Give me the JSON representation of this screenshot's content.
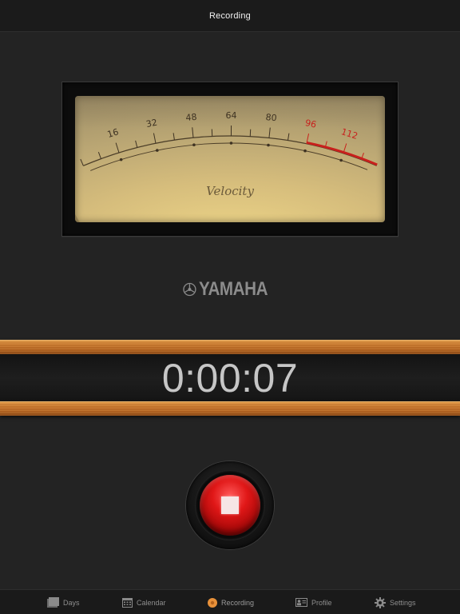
{
  "nav": {
    "title": "Recording"
  },
  "meter": {
    "label": "Velocity",
    "scale_labels": [
      "16",
      "32",
      "48",
      "64",
      "80",
      "96",
      "112"
    ],
    "scale_values": [
      16,
      32,
      48,
      64,
      80,
      96,
      112
    ],
    "scale_max": 127,
    "red_zone_start": 96,
    "needle_value": 0
  },
  "brand": {
    "name": "YAMAHA"
  },
  "timer": {
    "elapsed": "0:00:07"
  },
  "record": {
    "state": "recording"
  },
  "tabs": [
    {
      "label": "Days",
      "icon": "days-icon"
    },
    {
      "label": "Calendar",
      "icon": "calendar-icon"
    },
    {
      "label": "Recording",
      "icon": "recording-icon",
      "active": true
    },
    {
      "label": "Profile",
      "icon": "profile-icon"
    },
    {
      "label": "Settings",
      "icon": "gear-icon"
    }
  ],
  "colors": {
    "accent": "#e8913a",
    "record_red": "#e01717",
    "needle_red": "#c8201c",
    "wood": "#c9762c"
  }
}
